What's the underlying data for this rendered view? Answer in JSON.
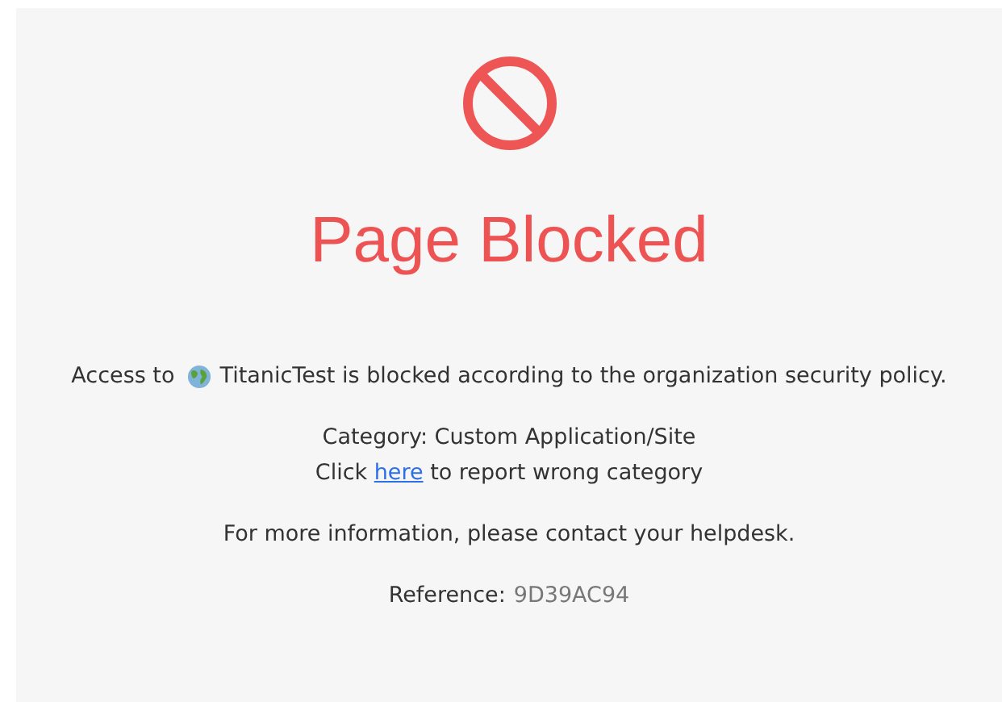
{
  "title": "Page Blocked",
  "access": {
    "prefix": "Access to",
    "site_message": "TitanicTest is blocked according to the organization security policy."
  },
  "category": "Category: Custom Application/Site",
  "report": {
    "before": "Click",
    "link": "here",
    "after": "to report wrong category"
  },
  "info": "For more information, please contact your helpdesk.",
  "reference": {
    "label": "Reference:",
    "value": "9D39AC94"
  }
}
